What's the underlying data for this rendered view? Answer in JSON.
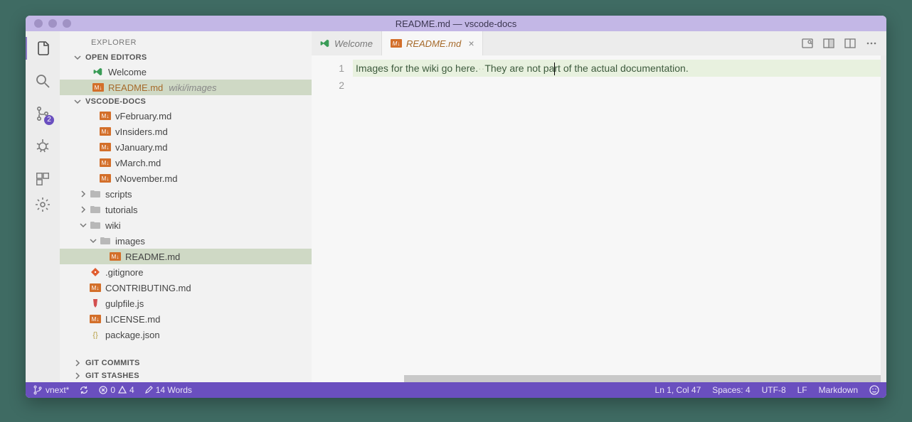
{
  "window": {
    "title": "README.md — vscode-docs"
  },
  "activitybar": {
    "scm_badge": "2"
  },
  "sidebar": {
    "title": "EXPLORER",
    "sections": {
      "openEditors": "OPEN EDITORS",
      "workspace": "VSCODE-DOCS",
      "gitCommits": "GIT COMMITS",
      "gitStashes": "GIT STASHES"
    },
    "openEditors": [
      {
        "label": "Welcome",
        "icon": "vs"
      },
      {
        "label": "README.md",
        "hint": "wiki/images",
        "icon": "md",
        "selected": true,
        "modified": true
      }
    ],
    "tree": {
      "files_top": [
        {
          "label": "vFebruary.md",
          "icon": "md"
        },
        {
          "label": "vInsiders.md",
          "icon": "md"
        },
        {
          "label": "vJanuary.md",
          "icon": "md"
        },
        {
          "label": "vMarch.md",
          "icon": "md"
        },
        {
          "label": "vNovember.md",
          "icon": "md"
        }
      ],
      "folders_mid": [
        {
          "label": "scripts",
          "expanded": false
        },
        {
          "label": "tutorials",
          "expanded": false
        }
      ],
      "wiki": {
        "label": "wiki",
        "expanded": true
      },
      "images": {
        "label": "images",
        "expanded": true
      },
      "readme": {
        "label": "README.md",
        "icon": "md",
        "selected": true
      },
      "files_bottom": [
        {
          "label": ".gitignore",
          "icon": "git"
        },
        {
          "label": "CONTRIBUTING.md",
          "icon": "md"
        },
        {
          "label": "gulpfile.js",
          "icon": "gulp"
        },
        {
          "label": "LICENSE.md",
          "icon": "md"
        },
        {
          "label": "package.json",
          "icon": "json"
        }
      ]
    }
  },
  "tabs": [
    {
      "label": "Welcome",
      "icon": "vs",
      "active": false
    },
    {
      "label": "README.md",
      "icon": "md",
      "active": true,
      "closable": true
    }
  ],
  "editor": {
    "lines": [
      {
        "num": "1",
        "segA": "Images for the wiki go here.",
        "segB": "They are not pa",
        "segC": "rt of the actual documentation."
      },
      {
        "num": "2",
        "text": ""
      }
    ]
  },
  "status": {
    "branch": "vnext*",
    "errors": "0",
    "warnings": "4",
    "words": "14 Words",
    "position": "Ln 1, Col 47",
    "spaces": "Spaces: 4",
    "encoding": "UTF-8",
    "eol": "LF",
    "language": "Markdown"
  }
}
